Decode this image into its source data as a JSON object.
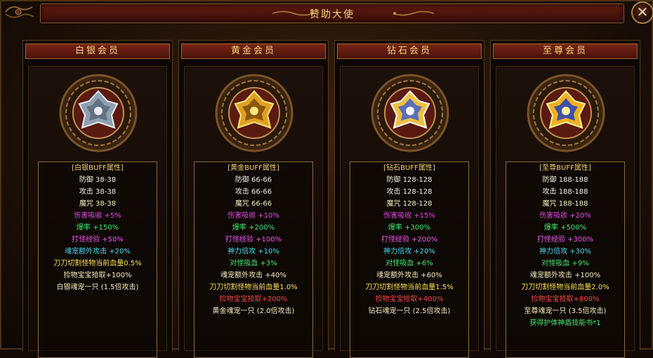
{
  "window": {
    "title": "赞助大使",
    "close_label": "✕"
  },
  "colors": {
    "head": "#f0d070",
    "white": "#f4f0e4",
    "pink": "#e845e8",
    "green": "#40e870",
    "cyan": "#4cd8f0",
    "orange": "#f0a050",
    "yellow": "#f8e050",
    "red": "#f04848"
  },
  "tiers": [
    {
      "name": "白银会员",
      "emblem": "silver-emblem",
      "stats": [
        {
          "text": "[白银BUFF属性]",
          "color": "head"
        },
        {
          "text": "防御  38-38",
          "color": "white"
        },
        {
          "text": "攻击  38-38",
          "color": "white"
        },
        {
          "text": "魔咒  38-38",
          "color": "lightyellow"
        },
        {
          "text": "伤害吸收  +5%",
          "color": "pink"
        },
        {
          "text": "爆率  +150%",
          "color": "green"
        },
        {
          "text": "打怪经验  +50%",
          "color": "magenta"
        },
        {
          "text": "魂宠额外攻击  +20%",
          "color": "cyan"
        },
        {
          "text": "刀刀切割怪物当前血量0.5%",
          "color": "yellow"
        },
        {
          "text": "捡物宝宝拾取+100%",
          "color": "lightyellow"
        },
        {
          "text": "白银魂宠一只 (1.5倍攻击)",
          "color": "lightyellow"
        }
      ]
    },
    {
      "name": "黄金会员",
      "emblem": "gold-emblem",
      "stats": [
        {
          "text": "[黄金BUFF属性]",
          "color": "head"
        },
        {
          "text": "防御  66-66",
          "color": "white"
        },
        {
          "text": "攻击  66-66",
          "color": "white"
        },
        {
          "text": "魔咒  66-66",
          "color": "lightyellow"
        },
        {
          "text": "伤害吸收  +10%",
          "color": "pink"
        },
        {
          "text": "爆率  +200%",
          "color": "green"
        },
        {
          "text": "打怪经验  +100%",
          "color": "magenta"
        },
        {
          "text": "神力倍攻  +10%",
          "color": "cyan"
        },
        {
          "text": "对怪吸血  +3%",
          "color": "green"
        },
        {
          "text": "魂宠额外攻击  +40%",
          "color": "lightyellow"
        },
        {
          "text": "刀刀切割怪物当前血量1.0%",
          "color": "yellow"
        },
        {
          "text": "捡物宝宝拾取+200%",
          "color": "red"
        },
        {
          "text": "黄金魂宠一只 (2.0倍攻击)",
          "color": "lightyellow"
        }
      ]
    },
    {
      "name": "钻石会员",
      "emblem": "diamond-emblem",
      "stats": [
        {
          "text": "[钻石BUFF属性]",
          "color": "head"
        },
        {
          "text": "防御  128-128",
          "color": "white"
        },
        {
          "text": "攻击  128-128",
          "color": "white"
        },
        {
          "text": "魔咒  128-128",
          "color": "lightyellow"
        },
        {
          "text": "伤害吸收  +15%",
          "color": "pink"
        },
        {
          "text": "爆率  +300%",
          "color": "green"
        },
        {
          "text": "打怪经验  +200%",
          "color": "magenta"
        },
        {
          "text": "神力倍攻  +20%",
          "color": "cyan"
        },
        {
          "text": "对怪吸血  +6%",
          "color": "green"
        },
        {
          "text": "魂宠额外攻击  +60%",
          "color": "lightyellow"
        },
        {
          "text": "刀刀切割怪物当前血量1.5%",
          "color": "yellow"
        },
        {
          "text": "捡物宝宝拾取+400%",
          "color": "red"
        },
        {
          "text": "钻石魂宠一只 (2.5倍攻击)",
          "color": "lightyellow"
        }
      ]
    },
    {
      "name": "至尊会员",
      "emblem": "supreme-emblem",
      "stats": [
        {
          "text": "[至尊BUFF属性]",
          "color": "head"
        },
        {
          "text": "防御  188-188",
          "color": "white"
        },
        {
          "text": "攻击  188-188",
          "color": "white"
        },
        {
          "text": "魔咒  188-188",
          "color": "lightyellow"
        },
        {
          "text": "伤害吸收  +20%",
          "color": "pink"
        },
        {
          "text": "爆率  +500%",
          "color": "green"
        },
        {
          "text": "打怪经验  +300%",
          "color": "magenta"
        },
        {
          "text": "神力倍攻  +30%",
          "color": "cyan"
        },
        {
          "text": "对怪吸血  +9%",
          "color": "green"
        },
        {
          "text": "魂宠额外攻击  +100%",
          "color": "lightyellow"
        },
        {
          "text": "刀刀切割怪物当前血量2.0%",
          "color": "yellow"
        },
        {
          "text": "捡物宝宝拾取+800%",
          "color": "red"
        },
        {
          "text": "至尊魂宠一只 (3.5倍攻击)",
          "color": "lightyellow"
        },
        {
          "text": "获得护体神盾技能书*1",
          "color": "green"
        }
      ]
    }
  ]
}
